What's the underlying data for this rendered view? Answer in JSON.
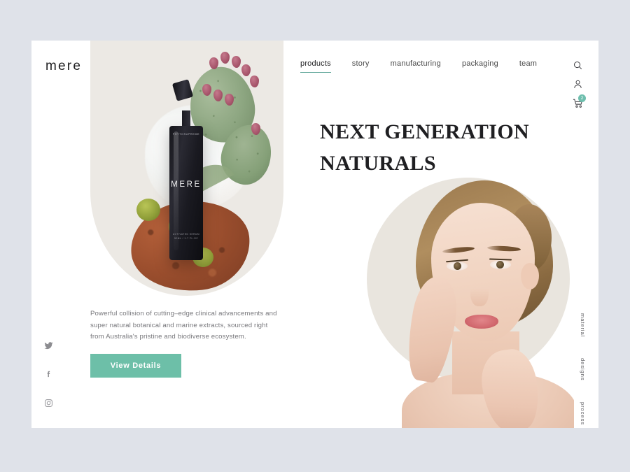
{
  "brand": {
    "logo": "mere"
  },
  "nav": {
    "items": [
      {
        "label": "products",
        "active": true
      },
      {
        "label": "story",
        "active": false
      },
      {
        "label": "manufacturing",
        "active": false
      },
      {
        "label": "packaging",
        "active": false
      },
      {
        "label": "team",
        "active": false
      }
    ]
  },
  "header_icons": {
    "search": "search-icon",
    "account": "user-icon",
    "cart": "cart-icon",
    "cart_badge": "2"
  },
  "hero": {
    "headline_line1": "NEXT GENERATION",
    "headline_line2": "NATURALS",
    "paragraph": "Powerful collision of cutting–edge clinical advancements and super natural botanical and marine extracts, sourced right from Australia's pristine and biodiverse ecosystem.",
    "cta_label": "View Details"
  },
  "product": {
    "bottle_brand": "MERE",
    "bottle_top_text": "PHYTOSUPREME",
    "bottle_sub_text": "ACTIVATED SERUM\n50ML / 1.7 FL.OZ"
  },
  "social": {
    "items": [
      {
        "name": "twitter-icon"
      },
      {
        "name": "facebook-icon"
      },
      {
        "name": "instagram-icon"
      }
    ]
  },
  "side_rail": {
    "items": [
      {
        "label": "material"
      },
      {
        "label": "designs"
      },
      {
        "label": "process"
      }
    ]
  },
  "colors": {
    "page_background": "#dfe2e9",
    "card_background": "#ffffff",
    "panel_beige": "#ece9e4",
    "accent_green": "#6dbfa8",
    "nav_underline": "#5aa396",
    "badge_green": "#6fbfae",
    "headline_text": "#1f1f22",
    "body_text": "#77777b"
  }
}
